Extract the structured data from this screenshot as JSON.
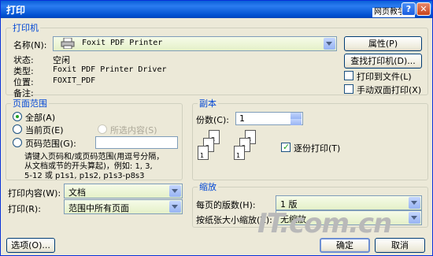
{
  "window": {
    "title": "打印",
    "help": "?",
    "close": "✕",
    "watermark_top": "网页教学网"
  },
  "printer": {
    "group_title": "打印机",
    "name_label": "名称(N):",
    "name_value": "Foxit PDF Printer",
    "status_label": "状态:",
    "status_value": "空闲",
    "type_label": "类型:",
    "type_value": "Foxit PDF Printer Driver",
    "where_label": "位置:",
    "where_value": "FOXIT_PDF",
    "comment_label": "备注:",
    "properties_button": "属性(P)",
    "find_button": "查找打印机(D)...",
    "print_to_file": "打印到文件(L)",
    "manual_duplex": "手动双面打印(X)"
  },
  "page_range": {
    "group_title": "页面范围",
    "all": "全部(A)",
    "current": "当前页(E)",
    "selection": "所选内容(S)",
    "pages": "页码范围(G):",
    "hint_line1": "请键入页码和/或页码范围(用逗号分隔，",
    "hint_line2": "从文档或节的开头算起)，例如: 1, 3,",
    "hint_line3": "5-12 或 p1s1, p1s2, p1s3-p8s3"
  },
  "copies": {
    "group_title": "副本",
    "count_label": "份数(C):",
    "count_value": "1",
    "collate": "逐份打印(T)",
    "page_numbers": [
      "1",
      "2",
      "3"
    ]
  },
  "print_what": {
    "label": "打印内容(W):",
    "value": "文档"
  },
  "print": {
    "label": "打印(R):",
    "value": "范围中所有页面"
  },
  "zoom": {
    "group_title": "缩放",
    "pages_per_sheet_label": "每页的版数(H):",
    "pages_per_sheet_value": "1 版",
    "scale_label": "按纸张大小缩放(Z):",
    "scale_value": "无缩放"
  },
  "footer": {
    "options": "选项(O)...",
    "ok": "确定",
    "cancel": "取消"
  },
  "watermark": "IT.com.cn"
}
